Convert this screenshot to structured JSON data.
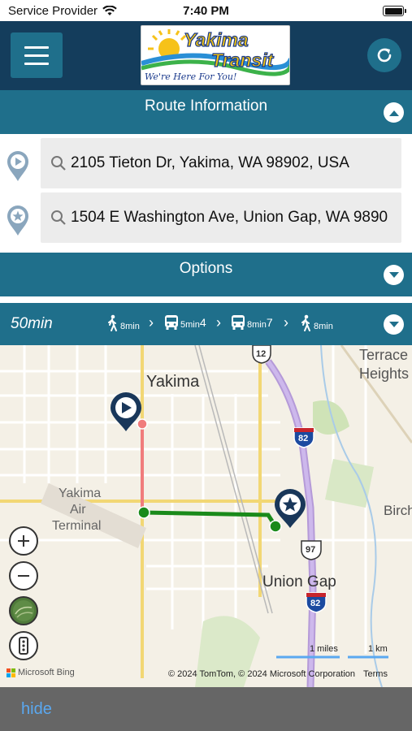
{
  "status_bar": {
    "carrier": "Service Provider",
    "time": "7:40 PM",
    "icons": [
      "wifi-icon",
      "battery-icon"
    ]
  },
  "header": {
    "logo_line1": "Yakima",
    "logo_line2": "Transit",
    "logo_tagline": "We're Here For You!",
    "icons": [
      "menu-icon",
      "refresh-icon"
    ]
  },
  "route_info": {
    "title": "Route Information",
    "origin": "2105 Tieton Dr, Yakima, WA 98902, USA",
    "destination": "1504 E Washington Ave, Union Gap, WA 9890"
  },
  "options": {
    "title": "Options"
  },
  "trip": {
    "duration": "50min",
    "legs": [
      {
        "icon": "walk-icon",
        "time": "8min",
        "route": ""
      },
      {
        "icon": "bus-icon",
        "time": "5min",
        "route": "4"
      },
      {
        "icon": "bus-icon",
        "time": "8min",
        "route": "7"
      },
      {
        "icon": "walk-icon",
        "time": "8min",
        "route": ""
      }
    ]
  },
  "map": {
    "labels": {
      "yakima": "Yakima",
      "terrace": "Terrace",
      "heights": "Heights",
      "airport_1": "Yakima",
      "airport_2": "Air",
      "airport_3": "Terminal",
      "birch": "Birch",
      "union_gap": "Union Gap"
    },
    "shields": {
      "us12": "12",
      "i82_north": "82",
      "us97": "97",
      "i82_south": "82"
    },
    "scale_miles": "1 miles",
    "scale_km": "1 km",
    "provider": "Microsoft Bing",
    "copyright": "© 2024 TomTom, © 2024 Microsoft Corporation",
    "terms": "Terms",
    "colors": {
      "walk": "#f07c7c",
      "bus": "#1a8a1a",
      "accent": "#1f6f8b",
      "header": "#143d5c"
    }
  },
  "bottom_bar": {
    "hide_label": "hide"
  }
}
